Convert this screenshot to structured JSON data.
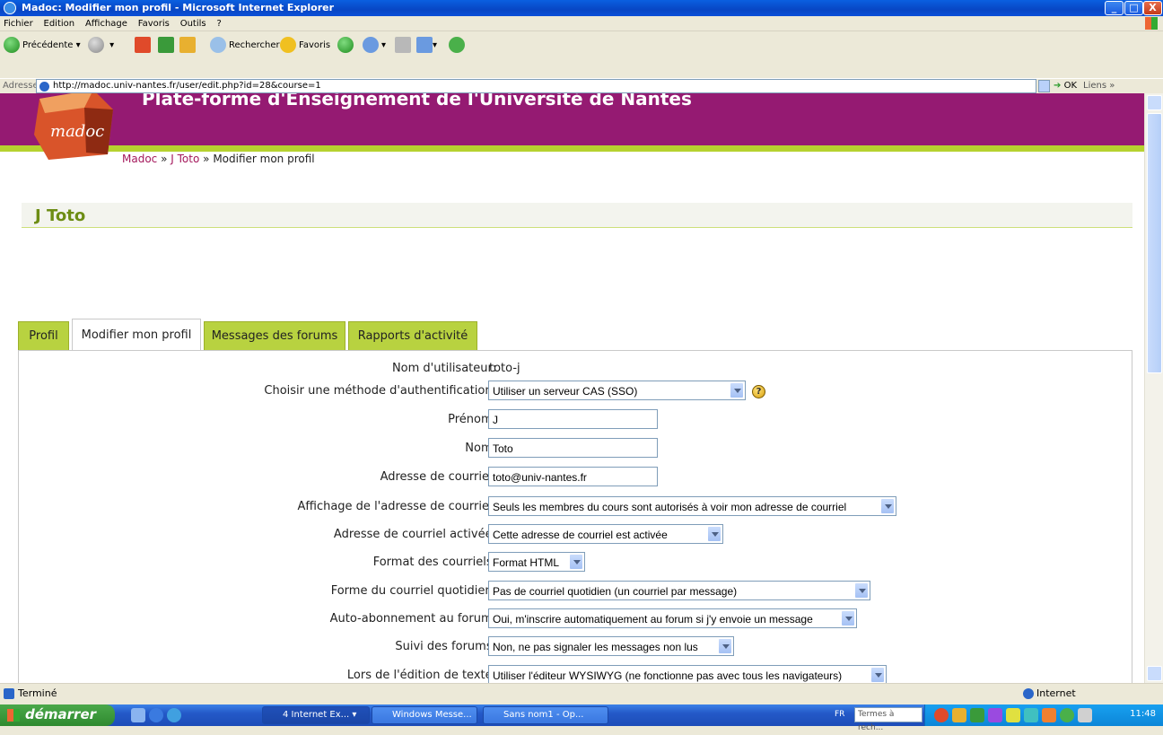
{
  "window": {
    "title": "Madoc: Modifier mon profil - Microsoft Internet Explorer"
  },
  "menu": [
    "Fichier",
    "Edition",
    "Affichage",
    "Favoris",
    "Outils",
    "?"
  ],
  "toolbar": {
    "back": "Précédente",
    "search": "Rechercher",
    "favorites": "Favoris"
  },
  "address": {
    "label": "Adresse",
    "url": "http://madoc.univ-nantes.fr/user/edit.php?id=28&course=1",
    "go": "OK",
    "links": "Liens"
  },
  "page": {
    "site_title": "Plate-forme d'Enseignement de l'Université de Nantes",
    "logo_text": "madoc",
    "breadcrumb": {
      "home": "Madoc",
      "sep1": "»",
      "user": "J Toto",
      "sep2": "»",
      "current": "Modifier mon profil"
    },
    "user_heading": "J Toto",
    "tabs": [
      "Profil",
      "Modifier mon profil",
      "Messages des forums",
      "Rapports d'activité"
    ],
    "form": {
      "username_label": "Nom d'utilisateur:",
      "username": "toto-j",
      "auth_label": "Choisir une méthode d'authentification:",
      "auth": "Utiliser un serveur CAS (SSO)",
      "firstname_label": "Prénom:",
      "firstname": "J",
      "lastname_label": "Nom:",
      "lastname": "Toto",
      "email_label": "Adresse de courriel:",
      "email": "toto@univ-nantes.fr",
      "emaildisplay_label": "Affichage de l'adresse de courriel:",
      "emaildisplay": "Seuls les membres du cours sont autorisés à voir mon adresse de courriel",
      "emailstop_label": "Adresse de courriel activée:",
      "emailstop": "Cette adresse de courriel est activée",
      "mailformat_label": "Format des courriels:",
      "mailformat": "Format HTML",
      "maildigest_label": "Forme du courriel quotidien:",
      "maildigest": "Pas de courriel quotidien (un courriel par message)",
      "autosub_label": "Auto-abonnement au forum:",
      "autosub": "Oui, m'inscrire automatiquement au forum si j'y envoie un message",
      "tracking_label": "Suivi des forums:",
      "tracking": "Non, ne pas signaler les messages non lus",
      "editor_label": "Lors de l'édition de texte:",
      "editor": "Utiliser l'éditeur WYSIWYG (ne fonctionne pas avec tous les navigateurs)"
    }
  },
  "status": {
    "text": "Terminé",
    "zone": "Internet"
  },
  "taskbar": {
    "start": "démarrer",
    "tasks": [
      "4 Internet Ex...",
      "Windows Messe...",
      "Sans nom1 - Op..."
    ],
    "lang": "FR",
    "search_placeholder": "Termes à rech...",
    "clock": "11:48"
  },
  "colors": {
    "header": "#951a72",
    "accent_green": "#b6d22f",
    "link": "#a4185c",
    "heading_green": "#6d8d14"
  }
}
